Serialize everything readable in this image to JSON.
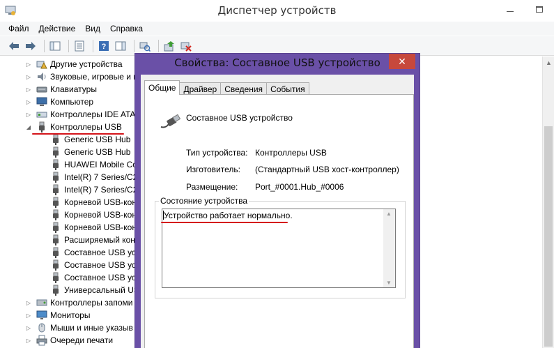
{
  "window": {
    "title": "Диспетчер устройств",
    "menu": [
      "Файл",
      "Действие",
      "Вид",
      "Справка"
    ]
  },
  "tree": {
    "items": [
      {
        "label": "Другие устройства",
        "level": 1,
        "expanded": false,
        "icon": "warning-device-icon"
      },
      {
        "label": "Звуковые, игровые и в",
        "level": 1,
        "expanded": false,
        "icon": "speaker-icon"
      },
      {
        "label": "Клавиатуры",
        "level": 1,
        "expanded": false,
        "icon": "keyboard-icon"
      },
      {
        "label": "Компьютер",
        "level": 1,
        "expanded": false,
        "icon": "computer-icon"
      },
      {
        "label": "Контроллеры IDE ATA",
        "level": 1,
        "expanded": false,
        "icon": "ide-controller-icon"
      },
      {
        "label": "Контроллеры USB",
        "level": 1,
        "expanded": true,
        "icon": "usb-plug-icon"
      },
      {
        "label": "Generic USB Hub",
        "level": 2,
        "icon": "usb-plug-icon"
      },
      {
        "label": "Generic USB Hub",
        "level": 2,
        "icon": "usb-plug-icon"
      },
      {
        "label": "HUAWEI Mobile Co",
        "level": 2,
        "icon": "usb-plug-icon"
      },
      {
        "label": "Intel(R) 7 Series/C21",
        "level": 2,
        "icon": "usb-plug-icon"
      },
      {
        "label": "Intel(R) 7 Series/C21",
        "level": 2,
        "icon": "usb-plug-icon"
      },
      {
        "label": "Корневой USB-кон",
        "level": 2,
        "icon": "usb-plug-icon"
      },
      {
        "label": "Корневой USB-кон",
        "level": 2,
        "icon": "usb-plug-icon"
      },
      {
        "label": "Корневой USB-кон",
        "level": 2,
        "icon": "usb-plug-icon"
      },
      {
        "label": "Расширяемый конт",
        "level": 2,
        "icon": "usb-plug-icon"
      },
      {
        "label": "Составное USB уст",
        "level": 2,
        "icon": "usb-plug-icon"
      },
      {
        "label": "Составное USB уст",
        "level": 2,
        "icon": "usb-plug-icon"
      },
      {
        "label": "Составное USB уст",
        "level": 2,
        "icon": "usb-plug-icon"
      },
      {
        "label": "Универсальный US",
        "level": 2,
        "icon": "usb-plug-icon"
      },
      {
        "label": "Контроллеры запоми",
        "level": 1,
        "expanded": false,
        "icon": "storage-controller-icon"
      },
      {
        "label": "Мониторы",
        "level": 1,
        "expanded": false,
        "icon": "monitor-icon"
      },
      {
        "label": "Мыши и иные указыв",
        "level": 1,
        "expanded": false,
        "icon": "mouse-icon"
      },
      {
        "label": "Очереди печати",
        "level": 1,
        "expanded": false,
        "icon": "printer-icon"
      }
    ]
  },
  "dialog": {
    "title": "Свойства: Составное USB устройство",
    "tabs": [
      "Общие",
      "Драйвер",
      "Сведения",
      "События"
    ],
    "device_name": "Составное USB устройство",
    "properties": [
      {
        "label": "Тип устройства:",
        "value": "Контроллеры USB"
      },
      {
        "label": "Изготовитель:",
        "value": "(Стандартный USB хост-контроллер)"
      },
      {
        "label": "Размещение:",
        "value": "Port_#0001.Hub_#0006"
      }
    ],
    "status_group_title": "Состояние устройства",
    "status_text": "Устройство работает нормально."
  },
  "colors": {
    "dialog_frame": "#6a50a7",
    "close_button": "#c7483c",
    "annotation_underline": "#d4141a"
  }
}
